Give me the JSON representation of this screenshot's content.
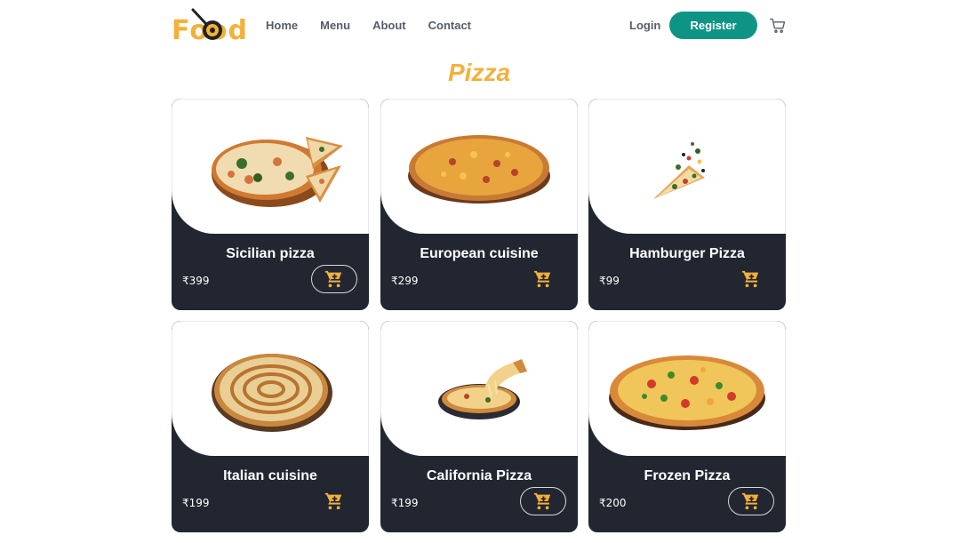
{
  "brand": {
    "logo_text": "Food",
    "accent": "#f2b13b",
    "primary": "#0e9484",
    "card_bg": "#212630"
  },
  "nav": {
    "items": [
      "Home",
      "Menu",
      "About",
      "Contact"
    ]
  },
  "auth": {
    "login": "Login",
    "register": "Register"
  },
  "page": {
    "title": "Pizza"
  },
  "products": [
    {
      "name": "Sicilian pizza",
      "price": "₹399",
      "button_outlined": true
    },
    {
      "name": "European cuisine",
      "price": "₹299",
      "button_outlined": false
    },
    {
      "name": "Hamburger Pizza",
      "price": "₹99",
      "button_outlined": false
    },
    {
      "name": "Italian cuisine",
      "price": "₹199",
      "button_outlined": false
    },
    {
      "name": "California Pizza",
      "price": "₹199",
      "button_outlined": true
    },
    {
      "name": "Frozen Pizza",
      "price": "₹200",
      "button_outlined": true
    }
  ],
  "icons": {
    "cart": "cart-icon",
    "product_cart": "add-to-cart-icon"
  }
}
